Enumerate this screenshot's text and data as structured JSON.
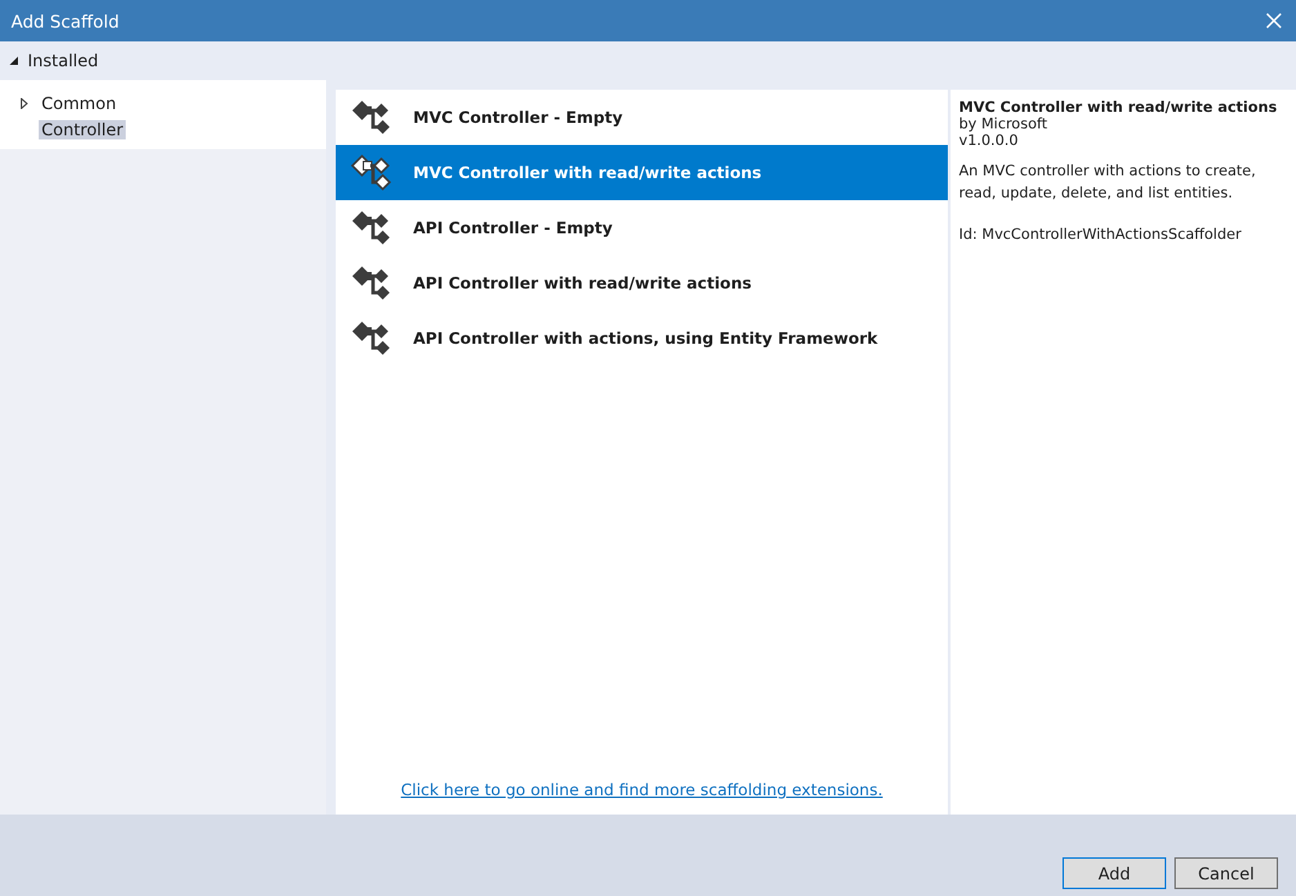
{
  "window": {
    "title": "Add Scaffold"
  },
  "installed": {
    "label": "Installed",
    "expanded": true
  },
  "tree": [
    {
      "label": "Common",
      "expanded": false,
      "selected": false
    },
    {
      "label": "Controller",
      "selected": true
    }
  ],
  "templates": [
    {
      "label": "MVC Controller - Empty",
      "selected": false
    },
    {
      "label": "MVC Controller with read/write actions",
      "selected": true
    },
    {
      "label": "API Controller - Empty",
      "selected": false
    },
    {
      "label": "API Controller with read/write actions",
      "selected": false
    },
    {
      "label": "API Controller with actions, using Entity Framework",
      "selected": false
    }
  ],
  "online_link": "Click here to go online and find more scaffolding extensions.",
  "details": {
    "title": "MVC Controller with read/write actions",
    "author": "by Microsoft",
    "version": "v1.0.0.0",
    "description": "An MVC controller with actions to create, read, update, delete, and list entities.",
    "id": "Id: MvcControllerWithActionsScaffolder"
  },
  "buttons": [
    {
      "label": "Add",
      "kind": "default"
    },
    {
      "label": "Cancel",
      "kind": "normal"
    }
  ]
}
